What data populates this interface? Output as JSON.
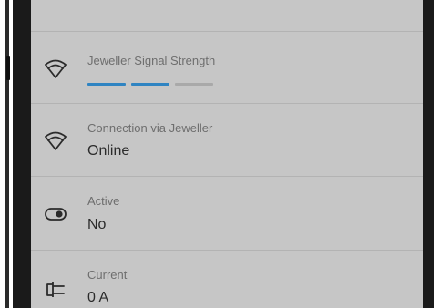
{
  "colors": {
    "screen_bg": "#c6c6c6",
    "bar_active": "#2f84c2",
    "bar_inactive": "#a9a9a9",
    "label": "#6e6e6e",
    "value": "#2b2b2b"
  },
  "rows": [
    {
      "label": "Jeweller Signal Strength",
      "icon": "wifi-icon",
      "signal_bars_total": 3,
      "signal_bars_filled": 2
    },
    {
      "label": "Connection via Jeweller",
      "value": "Online",
      "icon": "wifi-icon"
    },
    {
      "label": "Active",
      "value": "No",
      "icon": "toggle-icon"
    },
    {
      "label": "Current",
      "value": "0 A",
      "icon": "plug-icon"
    }
  ]
}
